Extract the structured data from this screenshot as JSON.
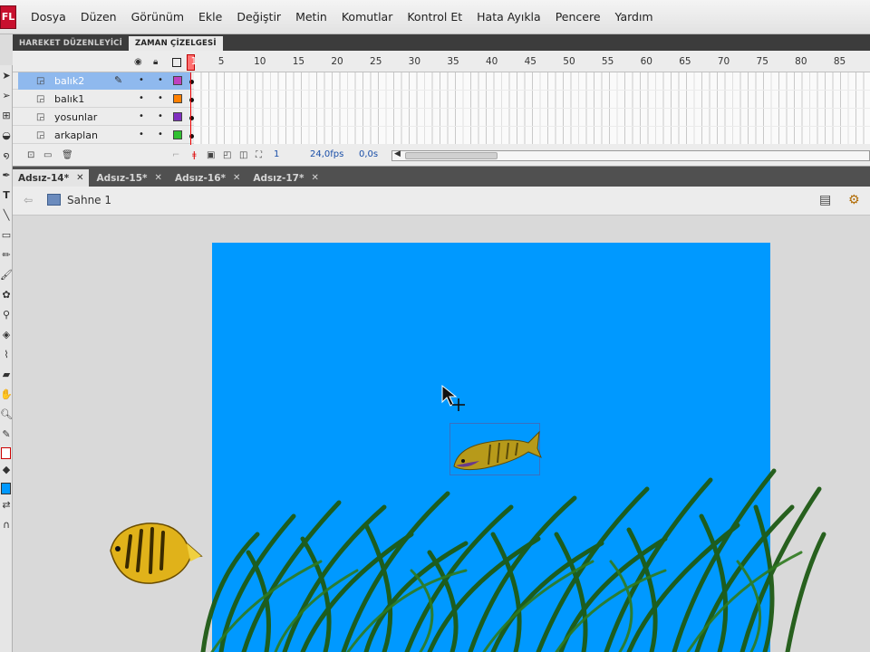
{
  "app": {
    "logo": "FL"
  },
  "menu": [
    "Dosya",
    "Düzen",
    "Görünüm",
    "Ekle",
    "Değiştir",
    "Metin",
    "Komutlar",
    "Kontrol Et",
    "Hata Ayıkla",
    "Pencere",
    "Yardım"
  ],
  "panel_tabs": [
    {
      "label": "HAREKET DÜZENLEYİCİ",
      "active": false
    },
    {
      "label": "ZAMAN ÇİZELGESİ",
      "active": true
    }
  ],
  "timeline": {
    "frame_numbers": [
      "1",
      "5",
      "10",
      "15",
      "20",
      "25",
      "30",
      "35",
      "40",
      "45",
      "50",
      "55",
      "60",
      "65",
      "70",
      "75",
      "80",
      "85"
    ],
    "header_icons": [
      "eye-icon",
      "lock-icon",
      "outline-icon"
    ],
    "layers": [
      {
        "name": "balık2",
        "selected": true,
        "color": "#c040c0"
      },
      {
        "name": "balık1",
        "selected": false,
        "color": "#ff8000"
      },
      {
        "name": "yosunlar",
        "selected": false,
        "color": "#8030c0"
      },
      {
        "name": "arkaplan",
        "selected": false,
        "color": "#30c030"
      }
    ],
    "footer": {
      "current_frame": "1",
      "fps": "24,0fps",
      "time": "0,0s"
    }
  },
  "doc_tabs": [
    {
      "label": "Adsız-14*",
      "active": true
    },
    {
      "label": "Adsız-15*",
      "active": false
    },
    {
      "label": "Adsız-16*",
      "active": false
    },
    {
      "label": "Adsız-17*",
      "active": false
    }
  ],
  "editbar": {
    "scene": "Sahne 1"
  },
  "colors": {
    "stage": "#0099ff",
    "selected_layer": "#8fb9ee",
    "grass": "#1e5a14",
    "fill_swatch": "#0099ff"
  }
}
